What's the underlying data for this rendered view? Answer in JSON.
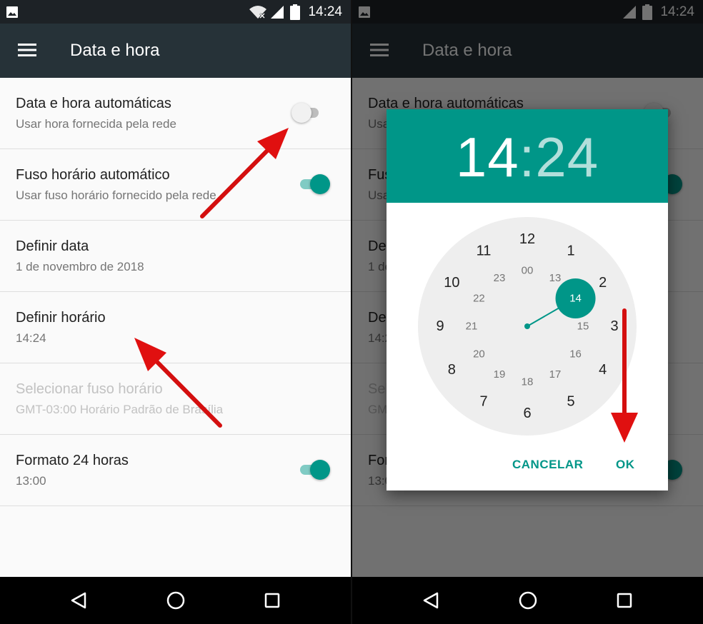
{
  "status_bar": {
    "time": "14:24"
  },
  "appbar": {
    "title": "Data e hora"
  },
  "settings": [
    {
      "title": "Data e hora automáticas",
      "subtitle": "Usar hora fornecida pela rede",
      "toggle": "off",
      "disabled": false
    },
    {
      "title": "Fuso horário automático",
      "subtitle": "Usar fuso horário fornecido pela rede",
      "toggle": "on",
      "disabled": false
    },
    {
      "title": "Definir data",
      "subtitle": "1 de novembro de 2018",
      "toggle": null,
      "disabled": false
    },
    {
      "title": "Definir horário",
      "subtitle": "14:24",
      "toggle": null,
      "disabled": false
    },
    {
      "title": "Selecionar fuso horário",
      "subtitle": "GMT-03:00 Horário Padrão de Brasília",
      "toggle": null,
      "disabled": true
    },
    {
      "title": "Formato 24 horas",
      "subtitle": "13:00",
      "toggle": "on",
      "disabled": false
    }
  ],
  "dialog": {
    "hour": "14",
    "colon": ":",
    "minute": "24",
    "clock_outer": [
      "12",
      "1",
      "2",
      "3",
      "4",
      "5",
      "6",
      "7",
      "8",
      "9",
      "10",
      "11"
    ],
    "clock_inner": [
      "00",
      "13",
      "14",
      "15",
      "16",
      "17",
      "18",
      "19",
      "20",
      "21",
      "22",
      "23"
    ],
    "selected": "14",
    "cancel_label": "CANCELAR",
    "ok_label": "OK"
  },
  "colors": {
    "accent": "#009688",
    "appbar": "#263238",
    "statusbar": "#1d2226",
    "arrow": "#e01010"
  },
  "icons": [
    "image-icon",
    "wifi-off-icon",
    "signal-icon",
    "battery-icon",
    "menu-icon",
    "back-icon",
    "home-icon",
    "recents-icon"
  ]
}
